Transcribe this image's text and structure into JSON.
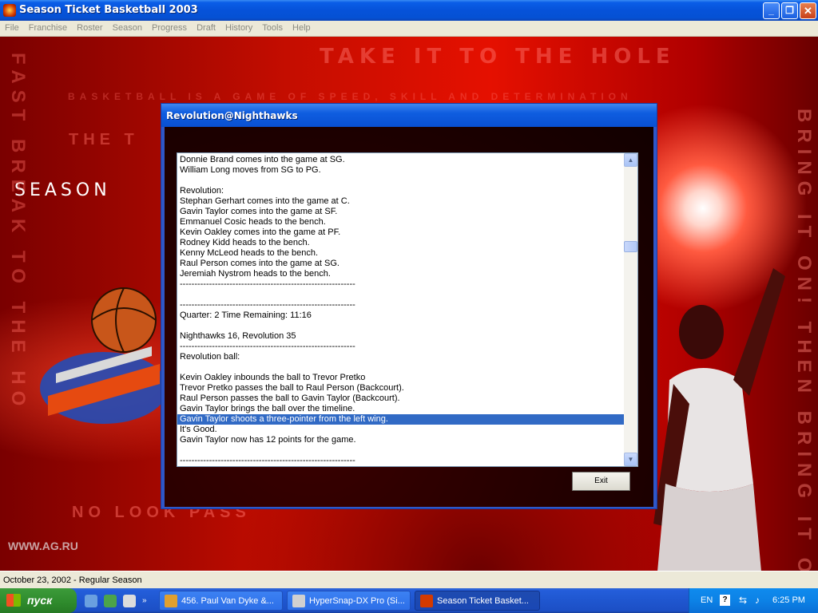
{
  "window": {
    "title": "Season Ticket Basketball 2003"
  },
  "menu": [
    "File",
    "Franchise",
    "Roster",
    "Season",
    "Progress",
    "Draft",
    "History",
    "Tools",
    "Help"
  ],
  "background_art": {
    "slogan_top": "TAKE IT TO THE HOLE",
    "slogan_sub": "BASKETBALL IS A GAME OF SPEED, SKILL AND DETERMINATION",
    "the_text": "THE T",
    "season_text": "SEASON",
    "left_vertical": "FAST BREAK TO THE HO",
    "right_vertical": "BRING IT ON! THEN BRING IT ON!",
    "no_look": "NO LOOK PASS",
    "watermark": "WWW.AG.RU"
  },
  "dialog": {
    "title": "Revolution@Nighthawks",
    "exit_label": "Exit",
    "log_lines": [
      "Donnie Brand comes into the game at SG.",
      "William Long moves from SG to PG.",
      "",
      "Revolution:",
      "Stephan Gerhart comes into the game at C.",
      "Gavin Taylor comes into the game at SF.",
      "Emmanuel Cosic heads to the bench.",
      "Kevin Oakley comes into the game at PF.",
      "Rodney Kidd heads to the bench.",
      "Kenny McLeod heads to the bench.",
      "Raul Person comes into the game at SG.",
      "Jeremiah Nystrom heads to the bench.",
      "------------------------------------------------------------",
      "",
      "------------------------------------------------------------",
      "Quarter: 2  Time Remaining: 11:16",
      "",
      "Nighthawks 16,  Revolution 35",
      "------------------------------------------------------------",
      "Revolution ball:",
      "",
      "Kevin Oakley inbounds the ball to Trevor Pretko",
      "Trevor Pretko passes the ball to Raul Person (Backcourt).",
      "Raul Person passes the ball to Gavin Taylor (Backcourt).",
      "Gavin Taylor brings the ball over the timeline.",
      "Gavin Taylor shoots a three-pointer from the left wing.",
      "It's Good.",
      "Gavin Taylor now has 12 points for the game.",
      "",
      "------------------------------------------------------------"
    ],
    "selected_line_index": 25
  },
  "statusbar": {
    "text": "October 23, 2002 - Regular Season"
  },
  "taskbar": {
    "start_label": "пуск",
    "tasks": [
      {
        "label": "456. Paul Van Dyke &...",
        "active": false
      },
      {
        "label": "HyperSnap-DX Pro (Si...",
        "active": false
      },
      {
        "label": "Season Ticket Basket...",
        "active": true
      }
    ],
    "tray": {
      "language": "EN",
      "help": "?",
      "clock": "6:25 PM"
    }
  },
  "colors": {
    "selection": "#316ac5",
    "dialog_frame": "#2f57c8",
    "background_red": "#c40d00"
  }
}
